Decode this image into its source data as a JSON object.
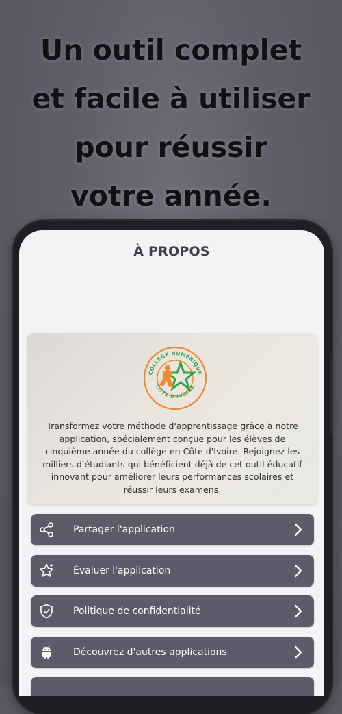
{
  "headline": {
    "line1": "Un outil complet",
    "line2": "et facile à utiliser",
    "line3": "pour réussir",
    "line4": "votre année."
  },
  "screen": {
    "title": "À PROPOS",
    "about": {
      "logo": {
        "icon": "college-numerique-logo-icon",
        "ring_text_top": "COLLÈGE NUMÉRIQUE",
        "ring_text_bottom": "CÔTE D'IVOIRE",
        "colors": {
          "orange": "#f0892b",
          "green": "#33a04a"
        }
      },
      "description": "Transformez votre méthode d'apprentissage grâce à notre application, spécialement conçue pour les élèves de cinquième année du collège en Côte d'Ivoire. Rejoignez les milliers d'étudiants qui bénéficient déjà de cet outil éducatif innovant pour améliorer leurs performances scolaires et réussir leurs examens."
    },
    "menu": [
      {
        "label": "Partager l'application",
        "icon": "share-icon"
      },
      {
        "label": "Évaluer l'application",
        "icon": "star-rate-icon"
      },
      {
        "label": "Politique de confidentialité",
        "icon": "shield-icon"
      },
      {
        "label": "Découvrez d'autres applications",
        "icon": "android-icon"
      }
    ]
  },
  "colors": {
    "background": "#5f5d69",
    "menu_item": "#5d5b69",
    "screen": "#f3f3f6",
    "headline_text": "#111114"
  }
}
